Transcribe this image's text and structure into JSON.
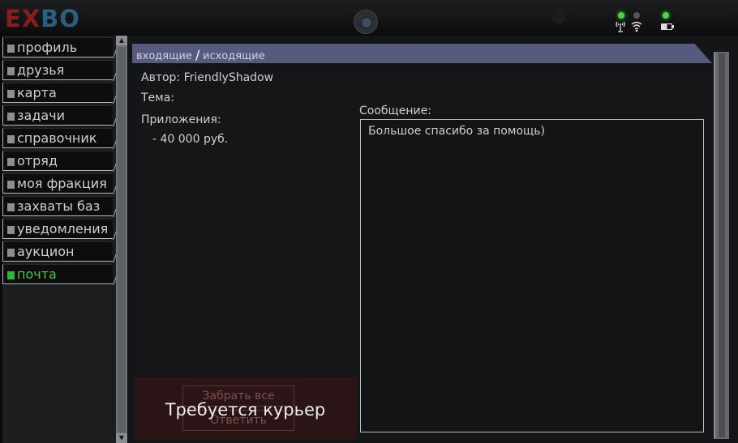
{
  "logo": {
    "part1": "EX",
    "part2": "BO"
  },
  "colors": {
    "accent_green": "#35d335",
    "tab_bar": "#565a7d",
    "action_area": "#2b1416"
  },
  "status_icons": [
    "antenna-icon",
    "wifi-icon",
    "battery-icon"
  ],
  "sidebar": {
    "items": [
      {
        "label": "профиль",
        "active": false
      },
      {
        "label": "друзья",
        "active": false
      },
      {
        "label": "карта",
        "active": false
      },
      {
        "label": "задачи",
        "active": false
      },
      {
        "label": "справочник",
        "active": false
      },
      {
        "label": "отряд",
        "active": false
      },
      {
        "label": "моя фракция",
        "active": false
      },
      {
        "label": "захваты баз",
        "active": false
      },
      {
        "label": "уведомления",
        "active": false
      },
      {
        "label": "аукцион",
        "active": false
      },
      {
        "label": "почта",
        "active": true
      }
    ]
  },
  "mail": {
    "tabs": {
      "incoming": "входящие",
      "separator": "/",
      "outgoing": "исходящие"
    },
    "author": "Автор: FriendlyShadow",
    "subject": "Тема:",
    "attachments_label": "Приложения:",
    "attachment_item": "- 40 000 руб.",
    "message_label": "Сообщение:",
    "message_text": "Большое спасибо за помощь)",
    "take_all_button": "Забрать все",
    "reply_button": "Ответить",
    "courier_notice": "Требуется курьер"
  }
}
